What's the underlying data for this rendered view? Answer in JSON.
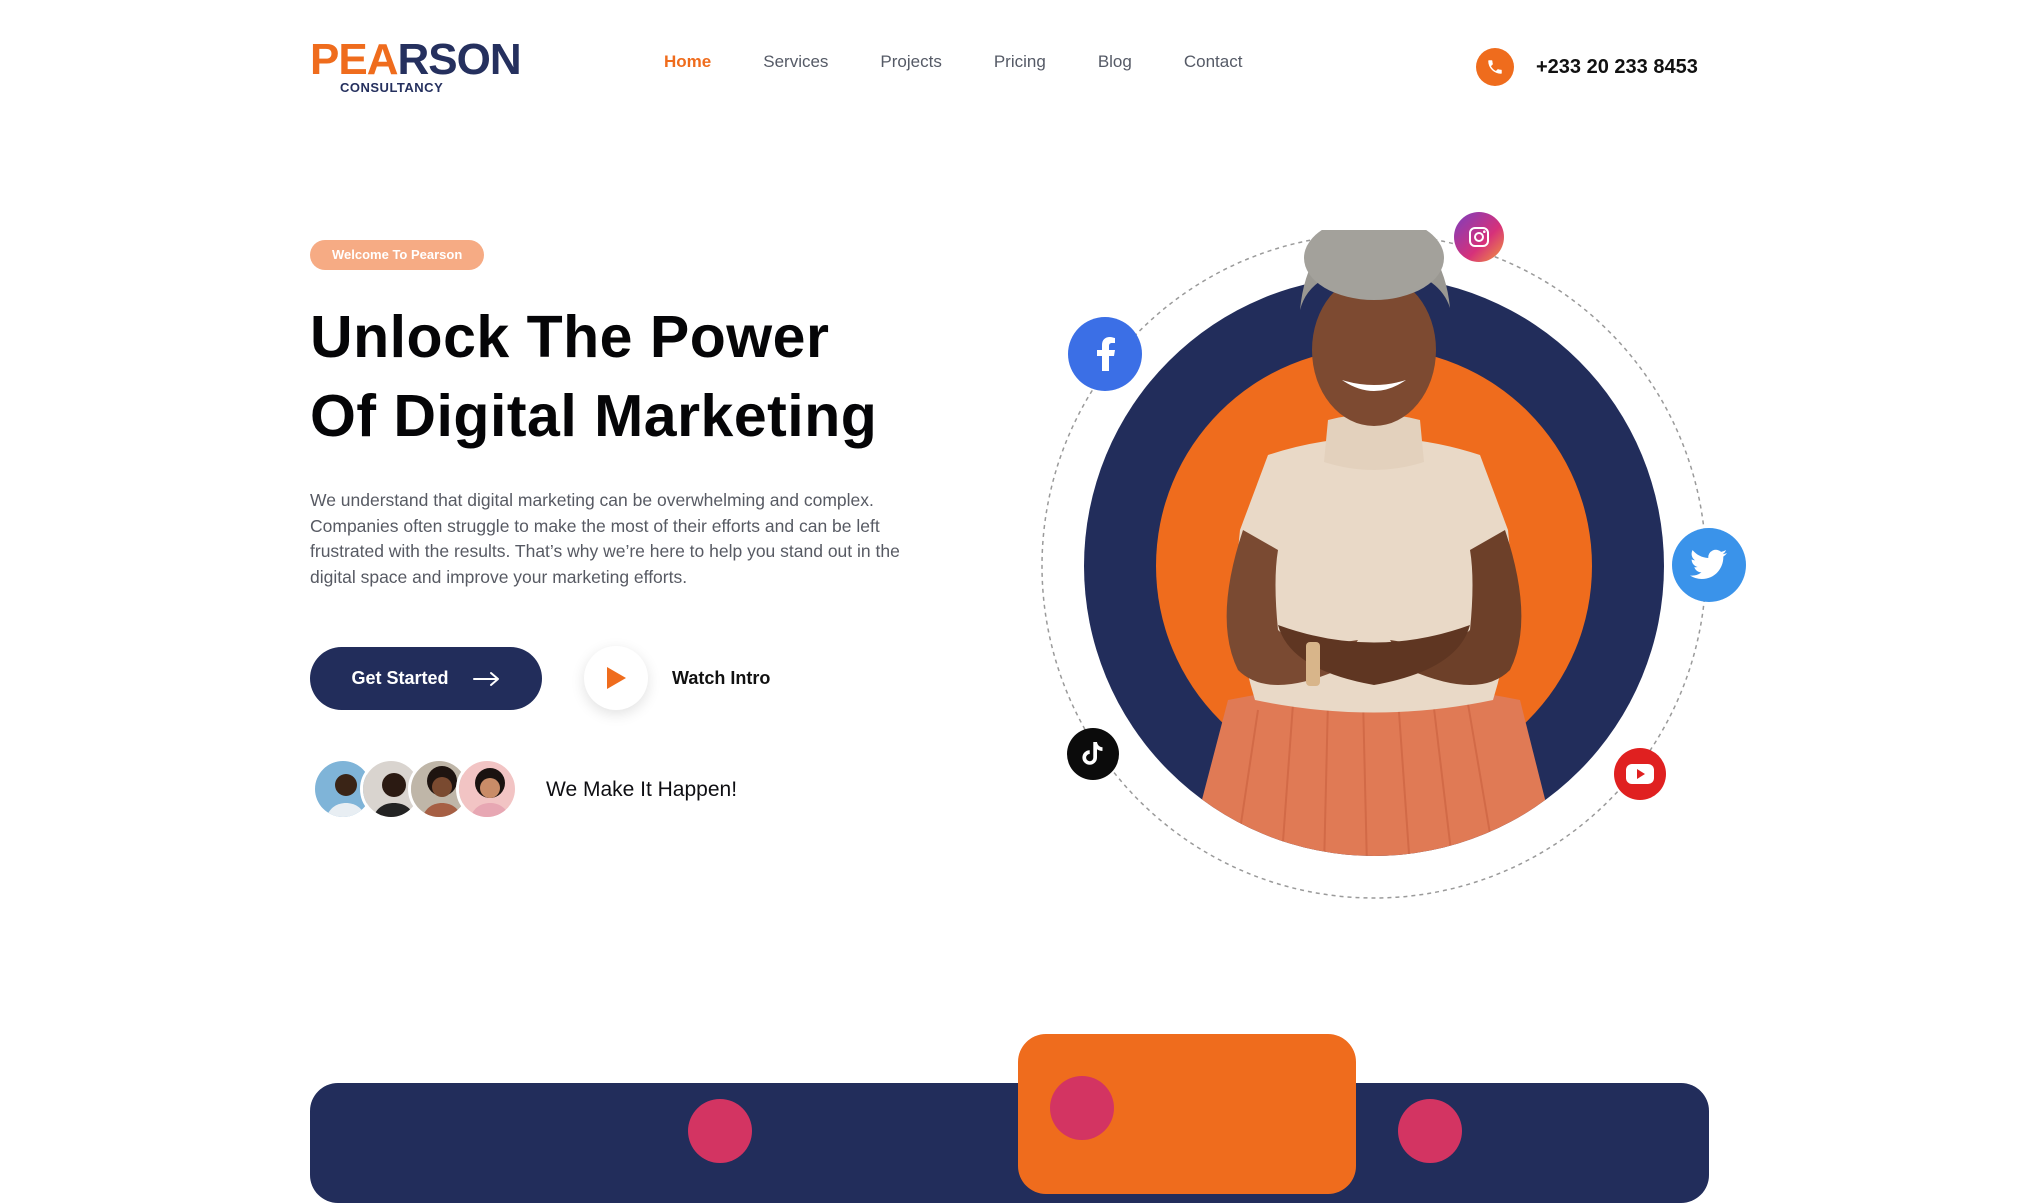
{
  "header": {
    "logo": {
      "word": "PEARSON",
      "word_parts": [
        "PE",
        "A",
        "RSON"
      ],
      "sub": "CONSULTANCY"
    },
    "nav": [
      {
        "label": "Home",
        "active": true
      },
      {
        "label": "Services",
        "active": false
      },
      {
        "label": "Projects",
        "active": false
      },
      {
        "label": "Pricing",
        "active": false
      },
      {
        "label": "Blog",
        "active": false
      },
      {
        "label": "Contact",
        "active": false
      }
    ],
    "phone": {
      "icon": "phone-icon",
      "number": "+233 20 233 8453"
    }
  },
  "hero": {
    "badge": "Welcome To Pearson",
    "headline_line1": "Unlock The Power",
    "headline_line2": "Of Digital Marketing",
    "description": "We understand that digital marketing can be overwhelming and complex. Companies often struggle to make the most of their efforts and can be left frustrated with the results. That’s why we’re here to help you stand out in the digital space and improve your marketing efforts.",
    "cta_label": "Get Started",
    "cta_icon": "arrow-right-icon",
    "watch_label": "Watch Intro",
    "watch_icon": "play-icon",
    "tagline": "We Make It Happen!"
  },
  "social": [
    {
      "name": "instagram",
      "icon": "instagram-icon",
      "color": "#c13584"
    },
    {
      "name": "facebook",
      "icon": "facebook-icon",
      "color": "#3b6fe6"
    },
    {
      "name": "twitter",
      "icon": "twitter-icon",
      "color": "#3a93ea"
    },
    {
      "name": "tiktok",
      "icon": "tiktok-icon",
      "color": "#0b0b0b"
    },
    {
      "name": "youtube",
      "icon": "youtube-icon",
      "color": "#e02020"
    }
  ],
  "colors": {
    "accent": "#ef6c1d",
    "navy": "#222d5b",
    "badge": "#f6ab84",
    "pink": "#d33462"
  }
}
